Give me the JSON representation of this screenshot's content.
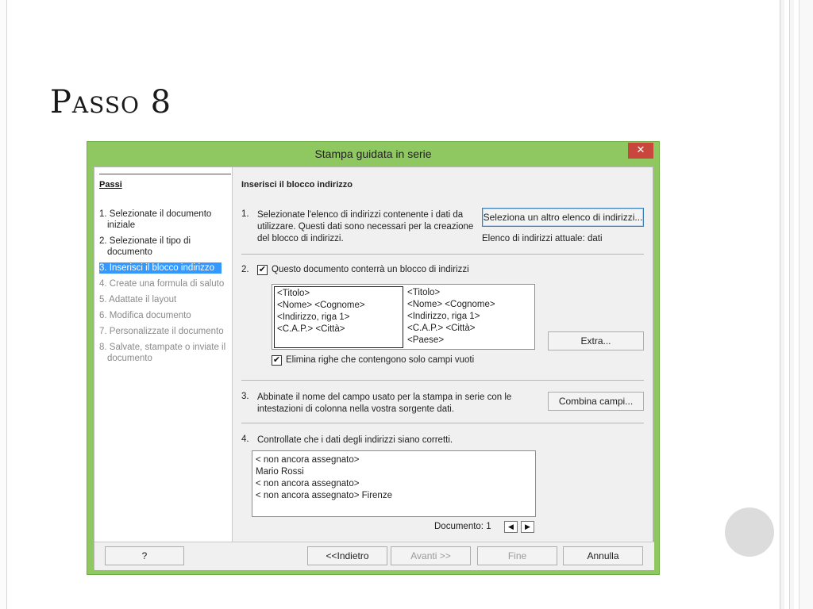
{
  "slide": {
    "title": "Passo 8"
  },
  "dialog": {
    "title": "Stampa guidata in serie",
    "close_symbol": "✕",
    "sidebar": {
      "header": "Passi",
      "steps": [
        "1. Selezionate il documento iniziale",
        "2. Selezionate il tipo di documento",
        "3. Inserisci il blocco indirizzo",
        "4. Create una formula di saluto",
        "5. Adattate il layout",
        "6. Modifica documento",
        "7. Personalizzate il documento",
        "8. Salvate, stampate o inviate il documento"
      ],
      "active_index": 2
    },
    "main": {
      "section_title": "Inserisci il blocco indirizzo",
      "step1": {
        "num": "1.",
        "text": "Selezionate l'elenco di indirizzi contenente i dati da utilizzare. Questi dati sono necessari per la creazione del blocco di indirizzi.",
        "button": "Seleziona un altro elenco di indirizzi...",
        "current_list": "Elenco di indirizzi attuale: dati"
      },
      "step2": {
        "num": "2.",
        "checkbox_label": "Questo documento conterrà un blocco di indirizzi",
        "checked": true,
        "address_block_1": [
          "<Titolo>",
          "<Nome> <Cognome>",
          "<Indirizzo, riga 1>",
          "<C.A.P.> <Città>"
        ],
        "address_block_2": [
          "<Titolo>",
          "<Nome> <Cognome>",
          "<Indirizzo, riga 1>",
          "<C.A.P.> <Città>",
          "<Paese>"
        ],
        "extra_button": "Extra...",
        "empty_lines_label": "Elimina righe che contengono solo campi vuoti",
        "empty_lines_checked": true
      },
      "step3": {
        "num": "3.",
        "text": "Abbinate il nome del campo usato per la stampa in serie con le intestazioni di colonna nella vostra sorgente dati.",
        "button": "Combina campi..."
      },
      "step4": {
        "num": "4.",
        "text": "Controllate che i dati degli indirizzi siano corretti.",
        "preview_lines": [
          "< non ancora assegnato>",
          "Mario Rossi",
          "< non ancora assegnato>",
          "< non ancora assegnato> Firenze"
        ],
        "document_label": "Documento: 1",
        "prev_symbol": "◀",
        "next_symbol": "▶"
      }
    },
    "footer": {
      "help": "?",
      "back": "<<Indietro",
      "next": "Avanti >>",
      "finish": "Fine",
      "cancel": "Annulla"
    },
    "colors": {
      "titlebar": "#8fc760",
      "close": "#c9463d",
      "selection": "#3399ff"
    }
  }
}
